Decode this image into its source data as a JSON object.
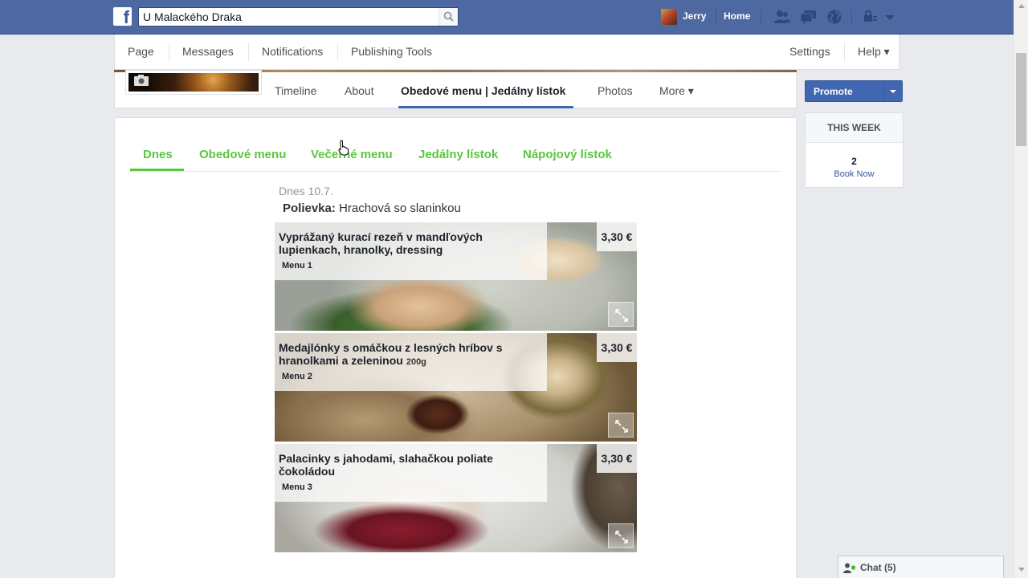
{
  "topbar": {
    "search_value": "U Malackého Draka",
    "user_name": "Jerry",
    "home_label": "Home"
  },
  "admin_nav": {
    "items": [
      {
        "label": "Page"
      },
      {
        "label": "Messages"
      },
      {
        "label": "Notifications"
      },
      {
        "label": "Publishing Tools"
      }
    ],
    "settings_label": "Settings",
    "help_label": "Help ▾"
  },
  "profile_tabs": {
    "items": [
      {
        "label": "Timeline"
      },
      {
        "label": "About"
      },
      {
        "label": "Obedové menu | Jedálny lístok"
      },
      {
        "label": "Photos"
      },
      {
        "label": "More ▾"
      }
    ]
  },
  "sidebar": {
    "promote_label": "Promote",
    "week_title": "THIS WEEK",
    "week_count": "2",
    "week_link": "Book Now"
  },
  "menu_app": {
    "tabs": [
      {
        "label": "Dnes"
      },
      {
        "label": "Obedové menu"
      },
      {
        "label": "Večerné menu"
      },
      {
        "label": "Jedálny lístok"
      },
      {
        "label": "Nápojový lístok"
      }
    ],
    "date_label": "Dnes 10.7.",
    "soup_label": "Polievka:",
    "soup_value": "Hrachová so slaninkou",
    "dishes": [
      {
        "name": "Vyprážaný kurací rezeň v mandľových lupienkach, hranolky, dressing",
        "weight": "",
        "menu": "Menu 1",
        "price": "3,30 €"
      },
      {
        "name": "Medajlónky s omáčkou z lesných hríbov s hranolkami a zeleninou",
        "weight": "200g",
        "menu": "Menu 2",
        "price": "3,30 €"
      },
      {
        "name": "Palacinky s jahodami, slahačkou poliate čokoládou",
        "weight": "",
        "menu": "Menu 3",
        "price": "3,30 €"
      }
    ]
  },
  "chat": {
    "label": "Chat (5)"
  },
  "colors": {
    "facebook_blue": "#4e69a2",
    "menu_green": "#5ac73f",
    "promote_blue": "#4267b2"
  }
}
